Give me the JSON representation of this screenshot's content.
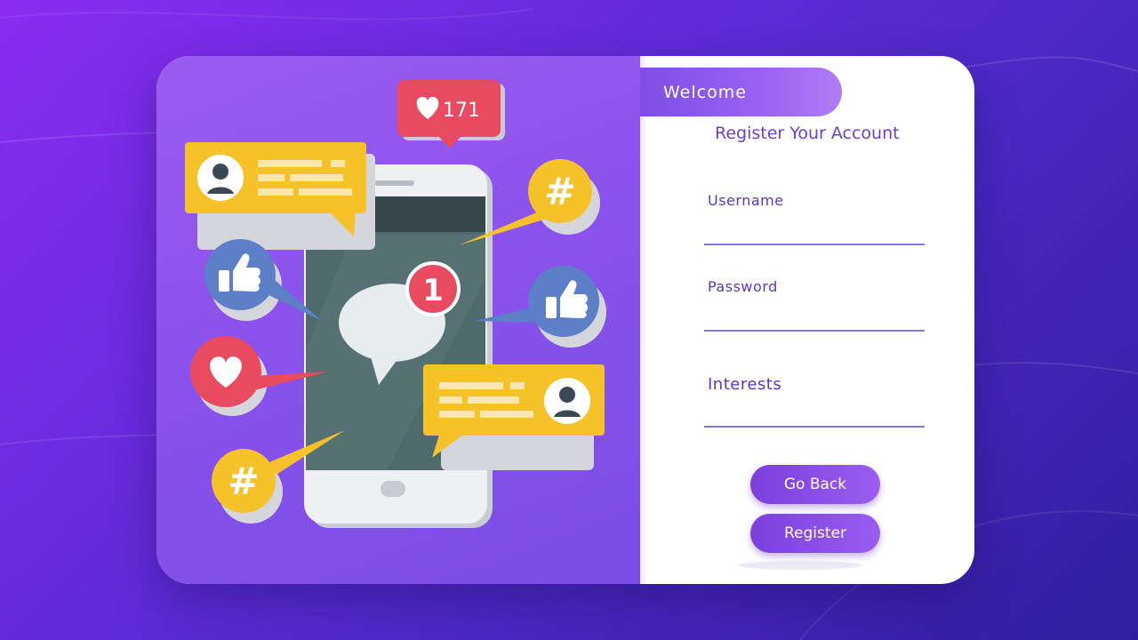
{
  "illustration": {
    "notification_count": "1",
    "likes_count": "171"
  },
  "form": {
    "welcome_tab": "Welcome",
    "title": "Register Your Account",
    "fields": [
      {
        "label": "Username"
      },
      {
        "label": "Password"
      },
      {
        "label": "Interests"
      }
    ],
    "go_back_label": "Go Back",
    "register_label": "Register"
  },
  "colors": {
    "accent": "#7b3fdc",
    "heading": "#6a3fd3",
    "line": "#8577e0",
    "background_start": "#8a2cf0",
    "background_end": "#2f1f9e"
  }
}
